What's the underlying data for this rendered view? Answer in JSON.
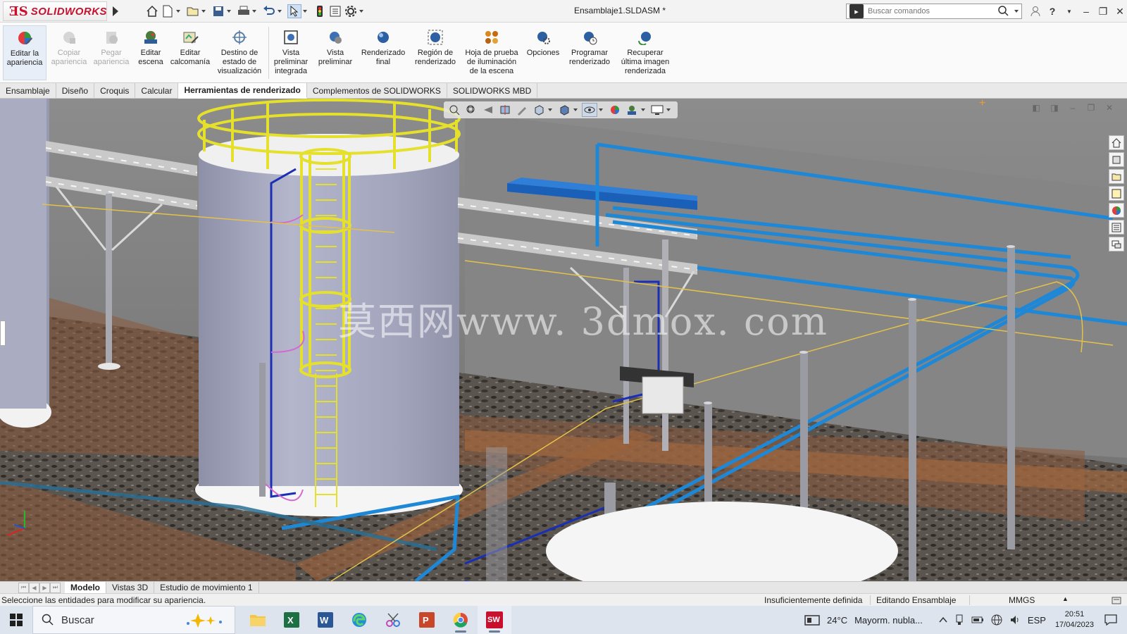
{
  "app": {
    "logo_text": "SOLIDWORKS",
    "document_title": "Ensamblaje1.SLDASM *",
    "search_placeholder": "Buscar comandos"
  },
  "ribbon": {
    "buttons": [
      {
        "label": "Editar la apariencia",
        "icon": "edit-appearance-icon",
        "enabled": true
      },
      {
        "label": "Copiar apariencia",
        "icon": "copy-appearance-icon",
        "enabled": false
      },
      {
        "label": "Pegar apariencia",
        "icon": "paste-appearance-icon",
        "enabled": false
      },
      {
        "label": "Editar escena",
        "icon": "edit-scene-icon",
        "enabled": true
      },
      {
        "label": "Editar calcomanía",
        "icon": "edit-decal-icon",
        "enabled": true
      },
      {
        "label": "Destino de estado de visualización",
        "icon": "display-state-target-icon",
        "enabled": true
      },
      {
        "label": "Vista preliminar integrada",
        "icon": "integrated-preview-icon",
        "enabled": true
      },
      {
        "label": "Vista preliminar",
        "icon": "preview-window-icon",
        "enabled": true
      },
      {
        "label": "Renderizado final",
        "icon": "final-render-icon",
        "enabled": true
      },
      {
        "label": "Región de renderizado",
        "icon": "render-region-icon",
        "enabled": true
      },
      {
        "label": "Hoja de prueba de iluminación de la escena",
        "icon": "scene-illumination-proof-sheet-icon",
        "enabled": true
      },
      {
        "label": "Opciones",
        "icon": "options-icon",
        "enabled": true
      },
      {
        "label": "Programar renderizado",
        "icon": "schedule-render-icon",
        "enabled": true
      },
      {
        "label": "Recuperar última imagen renderizada",
        "icon": "recall-last-render-icon",
        "enabled": true
      }
    ]
  },
  "tabs": [
    "Ensamblaje",
    "Diseño",
    "Croquis",
    "Calcular",
    "Herramientas de renderizado",
    "Complementos de SOLIDWORKS",
    "SOLIDWORKS MBD"
  ],
  "active_tab": "Herramientas de renderizado",
  "viewport": {
    "watermark": "莫西网www. 3dmox. com"
  },
  "model_tabs": [
    "Modelo",
    "Vistas 3D",
    "Estudio de movimiento 1"
  ],
  "active_model_tab": "Modelo",
  "status": {
    "message": "Seleccione las entidades para modificar su apariencia.",
    "definition": "Insuficientemente definida",
    "mode": "Editando Ensamblaje",
    "units": "MMGS"
  },
  "taskbar": {
    "search_placeholder": "Buscar",
    "weather_temp": "24°C",
    "weather_desc": "Mayorm. nubla...",
    "language": "ESP",
    "time": "20:51",
    "date": "17/04/2023"
  },
  "colors": {
    "brand_red": "#c8102e",
    "pipe_blue": "#1e88d6",
    "ladder_yellow": "#e4e02b",
    "floor_brown": "#8a5a3c"
  }
}
